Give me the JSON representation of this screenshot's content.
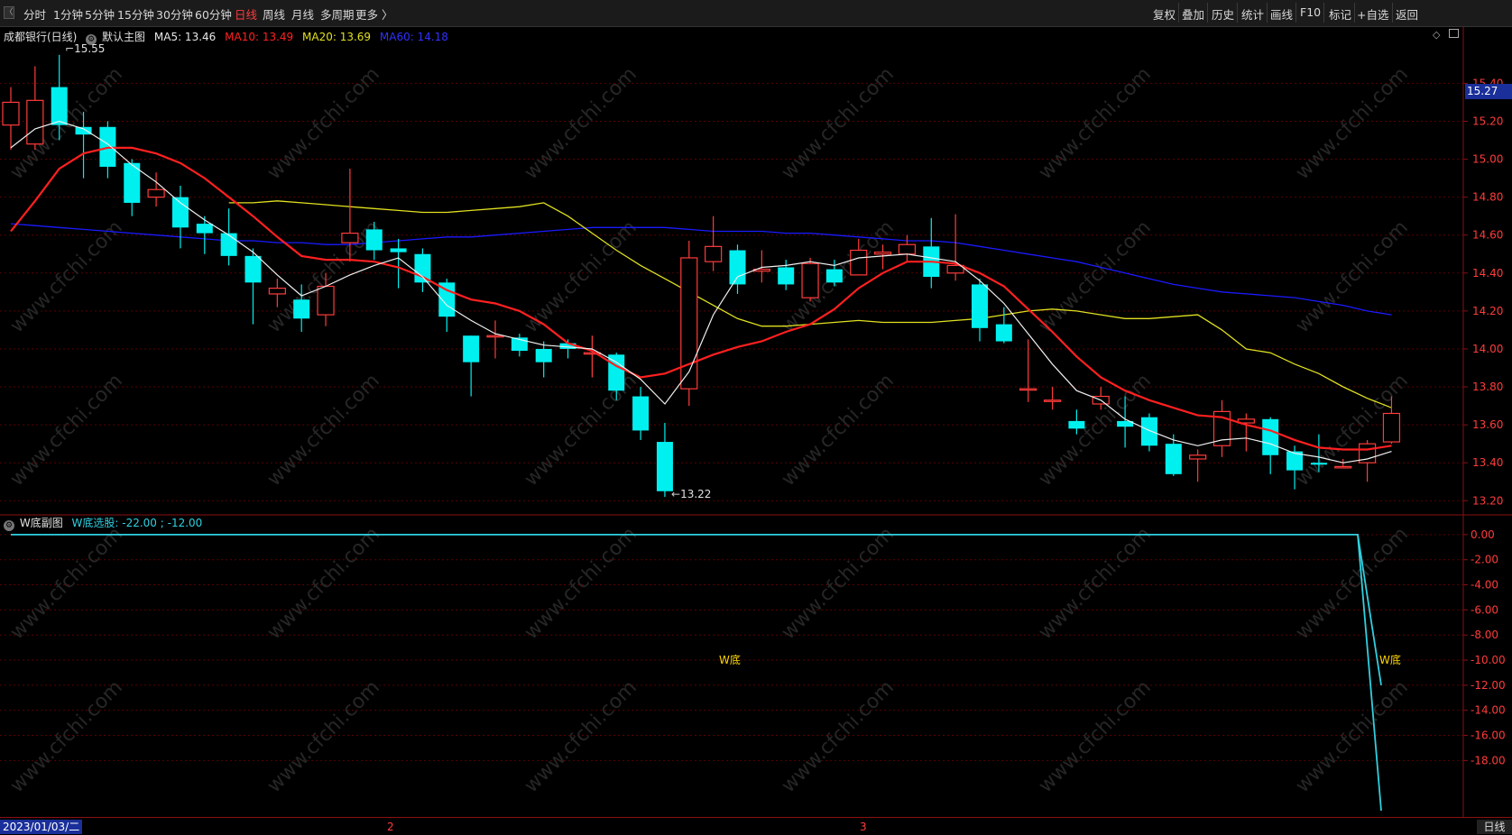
{
  "toolbar": {
    "left": [
      "分时",
      "1分钟",
      "5分钟",
      "15分钟",
      "30分钟",
      "60分钟",
      "日线",
      "周线",
      "月线",
      "多周期",
      "更多 〉"
    ],
    "active_index": 6,
    "right": [
      "复权",
      "叠加",
      "历史",
      "统计",
      "画线",
      "F10",
      "标记",
      "+自选",
      "返回"
    ],
    "back_glyph": "〈"
  },
  "main_info": {
    "stock": "成都银行(日线)",
    "template": "默认主图",
    "ma5": "MA5: 13.46",
    "ma10": "MA10: 13.49",
    "ma20": "MA20: 13.69",
    "ma60": "MA60: 14.18"
  },
  "colors": {
    "up": "#ff3b3b",
    "down": "#00f0f0",
    "ma5": "#f0f0f0",
    "ma10": "#ff2020",
    "ma20": "#e0e020",
    "ma60": "#1a1aff",
    "grid": "#5a0000",
    "axis": "#8a1010",
    "sub_line": "#30d0e0",
    "label_yellow": "#ffd700"
  },
  "annotations": {
    "high_label": "15.55",
    "low_label": "13.22",
    "current_price": "15.27"
  },
  "price_axis": [
    "15.40",
    "15.20",
    "15.00",
    "14.80",
    "14.60",
    "14.40",
    "14.20",
    "14.00",
    "13.80",
    "13.60",
    "13.40",
    "13.20"
  ],
  "sub_info": {
    "title": "W底副图",
    "indicator": "W底选股: -22.00 ; -12.00",
    "w_label_1": "W底",
    "w_label_2": "W底"
  },
  "sub_axis": [
    "0.00",
    "-2.00",
    "-4.00",
    "-6.00",
    "-8.00",
    "-10.00",
    "-12.00",
    "-14.00",
    "-16.00",
    "-18.00"
  ],
  "bottom_bar": {
    "date": "2023/01/03/二",
    "month_2": "2",
    "month_3": "3",
    "period": "日线"
  },
  "watermark": "www.cfchi.com",
  "chart_data": {
    "type": "candlestick",
    "ylim": [
      13.13,
      15.63
    ],
    "candles": [
      {
        "o": 15.18,
        "c": 15.3,
        "h": 15.38,
        "l": 15.05
      },
      {
        "o": 15.08,
        "c": 15.31,
        "h": 15.49,
        "l": 15.05
      },
      {
        "o": 15.38,
        "c": 15.18,
        "h": 15.55,
        "l": 15.1
      },
      {
        "o": 15.17,
        "c": 15.13,
        "h": 15.25,
        "l": 14.9
      },
      {
        "o": 15.17,
        "c": 14.96,
        "h": 15.2,
        "l": 14.9
      },
      {
        "o": 14.98,
        "c": 14.77,
        "h": 15.0,
        "l": 14.7
      },
      {
        "o": 14.8,
        "c": 14.84,
        "h": 14.93,
        "l": 14.75
      },
      {
        "o": 14.8,
        "c": 14.64,
        "h": 14.86,
        "l": 14.53
      },
      {
        "o": 14.66,
        "c": 14.61,
        "h": 14.7,
        "l": 14.5
      },
      {
        "o": 14.61,
        "c": 14.49,
        "h": 14.74,
        "l": 14.44
      },
      {
        "o": 14.49,
        "c": 14.35,
        "h": 14.53,
        "l": 14.13
      },
      {
        "o": 14.29,
        "c": 14.32,
        "h": 14.37,
        "l": 14.22
      },
      {
        "o": 14.26,
        "c": 14.16,
        "h": 14.34,
        "l": 14.09
      },
      {
        "o": 14.18,
        "c": 14.33,
        "h": 14.4,
        "l": 14.12
      },
      {
        "o": 14.56,
        "c": 14.61,
        "h": 14.95,
        "l": 14.46
      },
      {
        "o": 14.63,
        "c": 14.52,
        "h": 14.67,
        "l": 14.47
      },
      {
        "o": 14.53,
        "c": 14.51,
        "h": 14.58,
        "l": 14.32
      },
      {
        "o": 14.5,
        "c": 14.35,
        "h": 14.53,
        "l": 14.3
      },
      {
        "o": 14.35,
        "c": 14.17,
        "h": 14.37,
        "l": 14.09
      },
      {
        "o": 14.07,
        "c": 13.93,
        "h": 14.07,
        "l": 13.75
      },
      {
        "o": 14.07,
        "c": 14.07,
        "h": 14.15,
        "l": 13.95
      },
      {
        "o": 14.06,
        "c": 13.99,
        "h": 14.08,
        "l": 13.96
      },
      {
        "o": 14.0,
        "c": 13.93,
        "h": 14.04,
        "l": 13.85
      },
      {
        "o": 14.03,
        "c": 14.0,
        "h": 14.05,
        "l": 13.95
      },
      {
        "o": 13.98,
        "c": 13.98,
        "h": 14.07,
        "l": 13.85
      },
      {
        "o": 13.97,
        "c": 13.78,
        "h": 13.98,
        "l": 13.73
      },
      {
        "o": 13.75,
        "c": 13.57,
        "h": 13.8,
        "l": 13.52
      },
      {
        "o": 13.51,
        "c": 13.25,
        "h": 13.61,
        "l": 13.22
      },
      {
        "o": 13.79,
        "c": 14.48,
        "h": 14.57,
        "l": 13.7
      },
      {
        "o": 14.46,
        "c": 14.54,
        "h": 14.7,
        "l": 14.41
      },
      {
        "o": 14.52,
        "c": 14.34,
        "h": 14.55,
        "l": 14.29
      },
      {
        "o": 14.41,
        "c": 14.42,
        "h": 14.52,
        "l": 14.35
      },
      {
        "o": 14.43,
        "c": 14.34,
        "h": 14.47,
        "l": 14.31
      },
      {
        "o": 14.27,
        "c": 14.45,
        "h": 14.48,
        "l": 14.25
      },
      {
        "o": 14.42,
        "c": 14.35,
        "h": 14.47,
        "l": 14.33
      },
      {
        "o": 14.39,
        "c": 14.52,
        "h": 14.58,
        "l": 14.39
      },
      {
        "o": 14.5,
        "c": 14.51,
        "h": 14.55,
        "l": 14.42
      },
      {
        "o": 14.5,
        "c": 14.55,
        "h": 14.6,
        "l": 14.46
      },
      {
        "o": 14.54,
        "c": 14.38,
        "h": 14.69,
        "l": 14.32
      },
      {
        "o": 14.4,
        "c": 14.44,
        "h": 14.71,
        "l": 14.36
      },
      {
        "o": 14.34,
        "c": 14.11,
        "h": 14.37,
        "l": 14.04
      },
      {
        "o": 14.13,
        "c": 14.04,
        "h": 14.22,
        "l": 14.03
      },
      {
        "o": 13.79,
        "c": 13.79,
        "h": 14.05,
        "l": 13.72
      },
      {
        "o": 13.73,
        "c": 13.73,
        "h": 13.8,
        "l": 13.68
      },
      {
        "o": 13.62,
        "c": 13.58,
        "h": 13.68,
        "l": 13.55
      },
      {
        "o": 13.71,
        "c": 13.75,
        "h": 13.8,
        "l": 13.68
      },
      {
        "o": 13.62,
        "c": 13.59,
        "h": 13.75,
        "l": 13.48
      },
      {
        "o": 13.64,
        "c": 13.49,
        "h": 13.66,
        "l": 13.46
      },
      {
        "o": 13.5,
        "c": 13.34,
        "h": 13.55,
        "l": 13.33
      },
      {
        "o": 13.42,
        "c": 13.44,
        "h": 13.47,
        "l": 13.3
      },
      {
        "o": 13.49,
        "c": 13.67,
        "h": 13.73,
        "l": 13.43
      },
      {
        "o": 13.61,
        "c": 13.63,
        "h": 13.66,
        "l": 13.46
      },
      {
        "o": 13.63,
        "c": 13.44,
        "h": 13.64,
        "l": 13.34
      },
      {
        "o": 13.46,
        "c": 13.36,
        "h": 13.49,
        "l": 13.26
      },
      {
        "o": 13.4,
        "c": 13.39,
        "h": 13.55,
        "l": 13.35
      },
      {
        "o": 13.38,
        "c": 13.38,
        "h": 13.42,
        "l": 13.37
      },
      {
        "o": 13.4,
        "c": 13.5,
        "h": 13.52,
        "l": 13.3
      },
      {
        "o": 13.51,
        "c": 13.66,
        "h": 13.75,
        "l": 13.5
      }
    ],
    "ma5": [
      15.06,
      15.16,
      15.2,
      15.16,
      15.08,
      14.97,
      14.88,
      14.77,
      14.68,
      14.6,
      14.51,
      14.39,
      14.28,
      14.33,
      14.39,
      14.44,
      14.48,
      14.38,
      14.23,
      14.15,
      14.08,
      14.05,
      14.02,
      14.01,
      14.0,
      13.93,
      13.84,
      13.71,
      13.88,
      14.18,
      14.38,
      14.43,
      14.44,
      14.46,
      14.44,
      14.48,
      14.49,
      14.5,
      14.48,
      14.46,
      14.36,
      14.24,
      14.08,
      13.92,
      13.78,
      13.73,
      13.63,
      13.57,
      13.52,
      13.49,
      13.52,
      13.53,
      13.5,
      13.45,
      13.43,
      13.4,
      13.42,
      13.46
    ],
    "ma10": [
      14.62,
      14.78,
      14.95,
      15.03,
      15.06,
      15.06,
      15.03,
      14.98,
      14.9,
      14.8,
      14.7,
      14.59,
      14.49,
      14.47,
      14.47,
      14.46,
      14.43,
      14.38,
      14.31,
      14.26,
      14.24,
      14.2,
      14.13,
      14.03,
      13.99,
      13.91,
      13.85,
      13.87,
      13.92,
      13.97,
      14.01,
      14.04,
      14.09,
      14.13,
      14.21,
      14.32,
      14.4,
      14.46,
      14.46,
      14.45,
      14.4,
      14.33,
      14.21,
      14.09,
      13.96,
      13.85,
      13.78,
      13.73,
      13.69,
      13.65,
      13.64,
      13.6,
      13.57,
      13.52,
      13.48,
      13.47,
      13.47,
      13.49
    ],
    "ma20": [
      14.77,
      14.77,
      14.78,
      14.77,
      14.76,
      14.75,
      14.74,
      14.73,
      14.72,
      14.72,
      14.73,
      14.74,
      14.75,
      14.77,
      14.7,
      14.61,
      14.52,
      14.44,
      14.37,
      14.3,
      14.23,
      14.16,
      14.12,
      14.12,
      14.13,
      14.14,
      14.15,
      14.14,
      14.14,
      14.14,
      14.15,
      14.16,
      14.18,
      14.2,
      14.21,
      14.2,
      14.18,
      14.16,
      14.16,
      14.17,
      14.18,
      14.1,
      14.0,
      13.98,
      13.92,
      13.87,
      13.8,
      13.74,
      13.69
    ],
    "ma60": [
      14.66,
      14.65,
      14.64,
      14.63,
      14.62,
      14.61,
      14.6,
      14.59,
      14.58,
      14.57,
      14.57,
      14.56,
      14.56,
      14.55,
      14.55,
      14.56,
      14.57,
      14.58,
      14.59,
      14.59,
      14.6,
      14.61,
      14.62,
      14.63,
      14.64,
      14.64,
      14.64,
      14.64,
      14.63,
      14.62,
      14.62,
      14.62,
      14.61,
      14.61,
      14.6,
      14.59,
      14.58,
      14.57,
      14.57,
      14.56,
      14.54,
      14.52,
      14.5,
      14.48,
      14.46,
      14.43,
      14.4,
      14.37,
      14.34,
      14.32,
      14.3,
      14.29,
      14.28,
      14.27,
      14.25,
      14.23,
      14.2,
      14.18
    ],
    "sub_indicator": {
      "values_flat": 0.0,
      "drop_to": [
        -22.0,
        -12.0
      ]
    }
  }
}
